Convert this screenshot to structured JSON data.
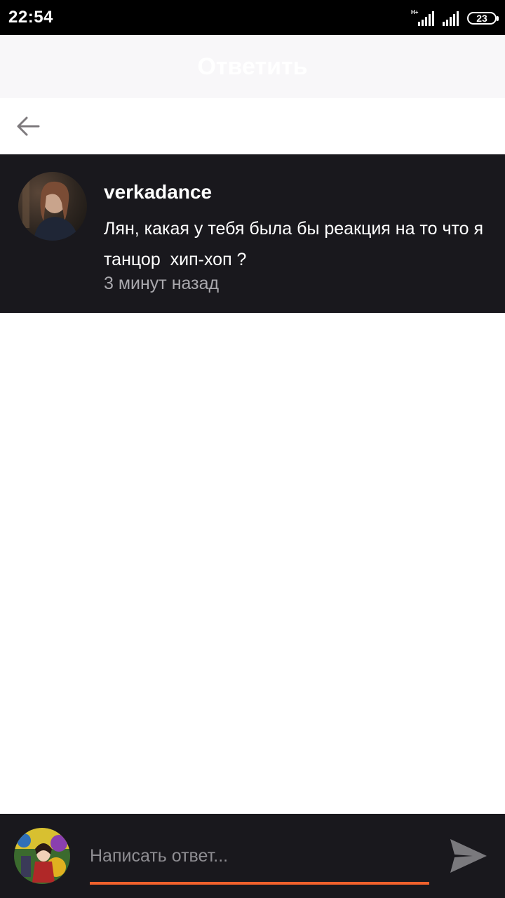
{
  "status_bar": {
    "time": "22:54",
    "network_type": "H+",
    "battery_level": "23",
    "signal_icon": "signal-bars-icon"
  },
  "header": {
    "title": "Ответить"
  },
  "nav": {
    "back_icon": "arrow-left-icon"
  },
  "comment": {
    "username": "verkadance",
    "text": "Лян, какая у тебя была бы реакция на то что я танцор  хип-хоп ?",
    "time_ago": "3 минут назад"
  },
  "reply": {
    "placeholder": "Написать ответ...",
    "send_icon": "send-icon"
  },
  "colors": {
    "dark_panel": "#19181d",
    "accent": "#f0612c",
    "muted_text": "#a9a8ad"
  }
}
